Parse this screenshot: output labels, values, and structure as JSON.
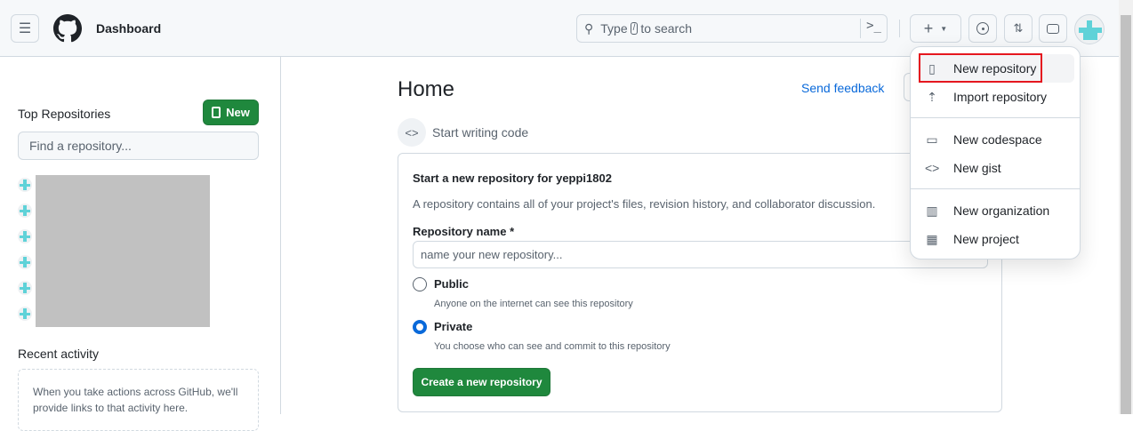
{
  "header": {
    "title": "Dashboard",
    "search_prefix": "Type",
    "search_key": "/",
    "search_suffix": "to search"
  },
  "sidebar": {
    "top_repos_title": "Top Repositories",
    "new_label": "New",
    "find_placeholder": "Find a repository...",
    "recent_title": "Recent activity",
    "recent_empty": "When you take actions across GitHub, we'll provide links to that activity here."
  },
  "main": {
    "title": "Home",
    "send_feedback": "Send feedback",
    "start_writing": "Start writing code",
    "card": {
      "heading": "Start a new repository for yeppi1802",
      "description": "A repository contains all of your project's files, revision history, and collaborator discussion.",
      "name_label": "Repository name *",
      "name_placeholder": "name your new repository...",
      "public_label": "Public",
      "public_desc": "Anyone on the internet can see this repository",
      "private_label": "Private",
      "private_desc": "You choose who can see and commit to this repository",
      "create_label": "Create a new repository",
      "selected_visibility": "Private"
    }
  },
  "dropdown": {
    "items": [
      {
        "label": "New repository"
      },
      {
        "label": "Import repository"
      },
      {
        "label": "New codespace"
      },
      {
        "label": "New gist"
      },
      {
        "label": "New organization"
      },
      {
        "label": "New project"
      }
    ]
  },
  "colors": {
    "accent": "#1f883d",
    "link": "#0969da",
    "highlight": "#e5171f"
  }
}
